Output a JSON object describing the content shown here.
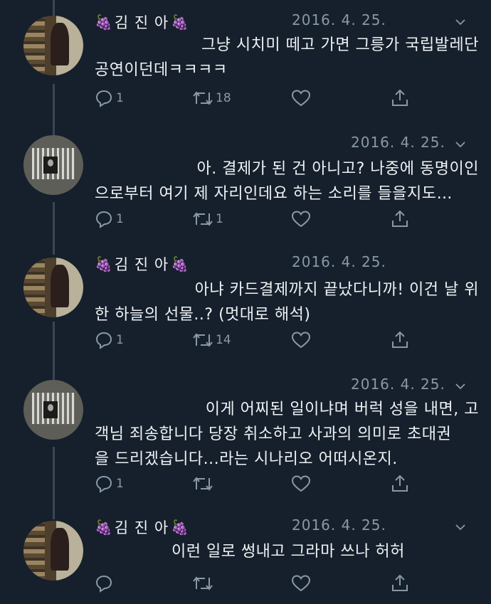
{
  "tweets": [
    {
      "author": "김 진 아",
      "show_name": true,
      "date": "2016. 4. 25.",
      "lines": [
        "그냥 시치미 떼고 가면 그릉가 국립발레단",
        "공연이던데ㅋㅋㅋㅋ"
      ],
      "replies": "1",
      "retweets": "18",
      "likes": ""
    },
    {
      "author": "",
      "show_name": false,
      "date": "2016. 4. 25.",
      "lines": [
        "아. 결제가 된 건 아니고? 나중에 동명이인",
        "으로부터 여기 제 자리인데요 하는 소리를 들을지도…"
      ],
      "replies": "1",
      "retweets": "1",
      "likes": ""
    },
    {
      "author": "김 진 아",
      "show_name": true,
      "date": "2016. 4. 25.",
      "lines": [
        "아냐 카드결제까지 끝났다니까! 이건 날 위",
        "한 하늘의 선물..? (멋대로 해석)"
      ],
      "replies": "1",
      "retweets": "14",
      "likes": ""
    },
    {
      "author": "",
      "show_name": false,
      "date": "2016. 4. 25.",
      "lines": [
        "이게 어찌된 일이냐며 버럭 성을 내면, 고",
        "객님 죄송합니다 당장 취소하고 사과의 의미로 초대권",
        "을 드리겠습니다...라는 시나리오 어떠시온지."
      ],
      "replies": "1",
      "retweets": "",
      "likes": ""
    },
    {
      "author": "김 진 아",
      "show_name": true,
      "date": "2016. 4. 25.",
      "lines": [
        "이런 일로 썽내고 그라마 쓰나 허허"
      ],
      "replies": "",
      "retweets": "",
      "likes": ""
    }
  ],
  "icons": {
    "grape": "grape-emoji",
    "reply": "reply-icon",
    "retweet": "retweet-icon",
    "like": "heart-icon",
    "share": "share-icon",
    "caret": "chevron-down-icon"
  },
  "colors": {
    "background": "#16202c",
    "muted": "#8899a6",
    "text": "#eef2f5"
  }
}
